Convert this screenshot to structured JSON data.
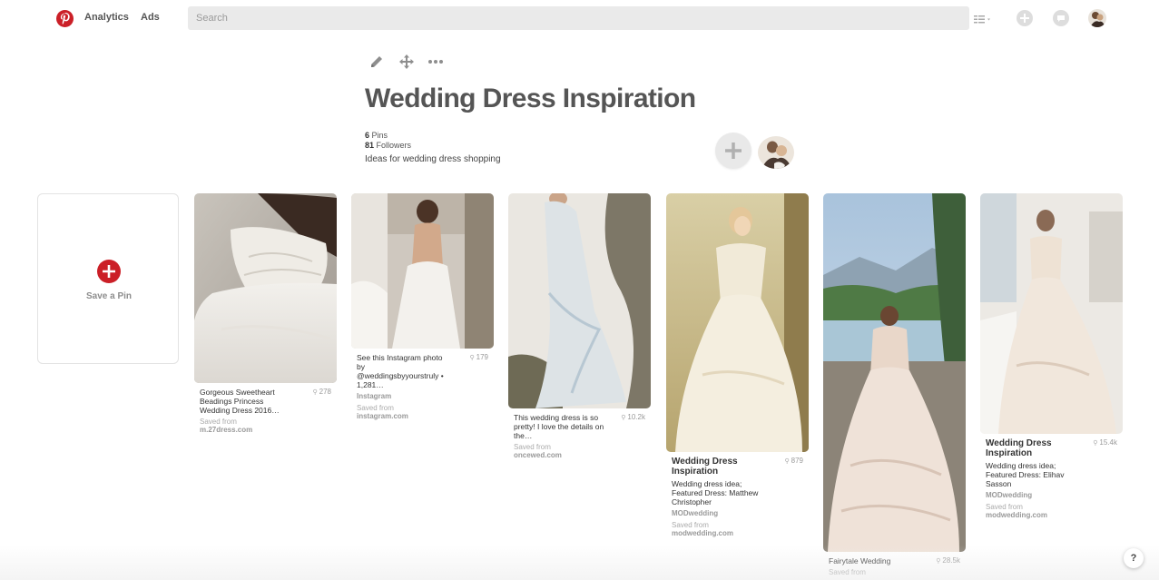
{
  "header": {
    "nav": [
      {
        "label": "Analytics"
      },
      {
        "label": "Ads"
      }
    ],
    "search_placeholder": "Search",
    "icons": [
      "pinterest-logo",
      "list-view-icon",
      "add-icon",
      "messages-icon",
      "profile-avatar"
    ]
  },
  "board": {
    "tools": [
      "edit-icon",
      "move-icon",
      "more-icon"
    ],
    "title": "Wedding Dress Inspiration",
    "pins_count": "6",
    "pins_label": "Pins",
    "followers_count": "81",
    "followers_label": "Followers",
    "description": "Ideas for wedding dress shopping"
  },
  "save_card": {
    "label": "Save a Pin"
  },
  "pins": [
    {
      "description": "Gorgeous Sweetheart Beadings Princess Wedding Dress 2016…",
      "count": "278",
      "source": "",
      "saved_label": "Saved from",
      "domain": "m.27dress.com"
    },
    {
      "description": "See this Instagram photo by @weddingsbyyourstruly • 1,281…",
      "count": "179",
      "source": "Instagram",
      "saved_label": "Saved from",
      "domain": "instagram.com"
    },
    {
      "description": "This wedding dress is so pretty! I love the details on the…",
      "count": "10.2k",
      "source": "",
      "saved_label": "Saved from",
      "domain": "oncewed.com"
    },
    {
      "title": "Wedding Dress Inspiration",
      "description": "Wedding dress idea; Featured Dress: Matthew Christopher",
      "count": "879",
      "source": "MODwedding",
      "saved_label": "Saved from",
      "domain": "modwedding.com"
    },
    {
      "description": "Fairytale Wedding",
      "count": "28.5k",
      "source": "",
      "saved_label": "Saved from",
      "domain": ""
    },
    {
      "title": "Wedding Dress Inspiration",
      "description": "Wedding dress idea; Featured Dress: Elihav Sasson",
      "count": "15.4k",
      "source": "MODwedding",
      "saved_label": "Saved from",
      "domain": "modwedding.com"
    }
  ],
  "help_label": "?",
  "colors": {
    "brand_red": "#cb1f27",
    "search_bg": "#eaeaea"
  }
}
